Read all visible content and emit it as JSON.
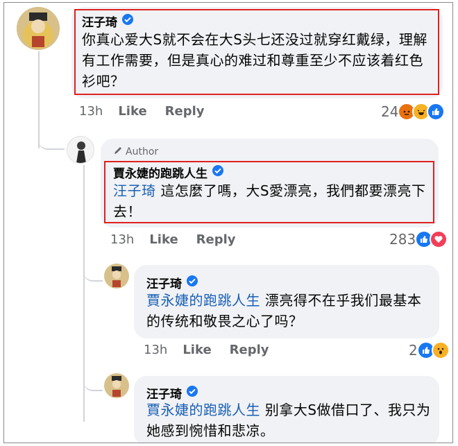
{
  "comments": [
    {
      "name": "汪子琦",
      "text": "你真心爱大S就不会在大S头七还没过就穿红戴绿，理解有工作需要，但是真心的难过和尊重至少不应该着红色衫吧？",
      "time": "13h",
      "like": "Like",
      "reply": "Reply",
      "reactions": "24",
      "reaction_icons": [
        "angry",
        "haha",
        "like"
      ]
    },
    {
      "author_badge": "Author",
      "name": "賈永婕的跑跳人生",
      "mention": "汪子琦",
      "text": " 這怎麼了嗎，大S愛漂亮，我們都要漂亮下去！",
      "time": "13h",
      "like": "Like",
      "reply": "Reply",
      "reactions": "283",
      "reaction_icons": [
        "like",
        "love"
      ]
    },
    {
      "name": "汪子琦",
      "mention": "賈永婕的跑跳人生",
      "text": " 漂亮得不在乎我们最基本的传统和敬畏之心了吗？",
      "time": "13h",
      "like": "Like",
      "reply": "Reply",
      "reactions": "2",
      "reaction_icons": [
        "like",
        "wow"
      ]
    },
    {
      "name": "汪子琦",
      "mention": "賈永婕的跑跳人生",
      "text": " 别拿大S做借口了、我只为她感到惋惜和悲凉。"
    }
  ],
  "colors": {
    "highlight_box": "#e02020",
    "mention": "#1a5fb4",
    "verified": "#1877f2",
    "bubble": "#f0f2f5"
  }
}
